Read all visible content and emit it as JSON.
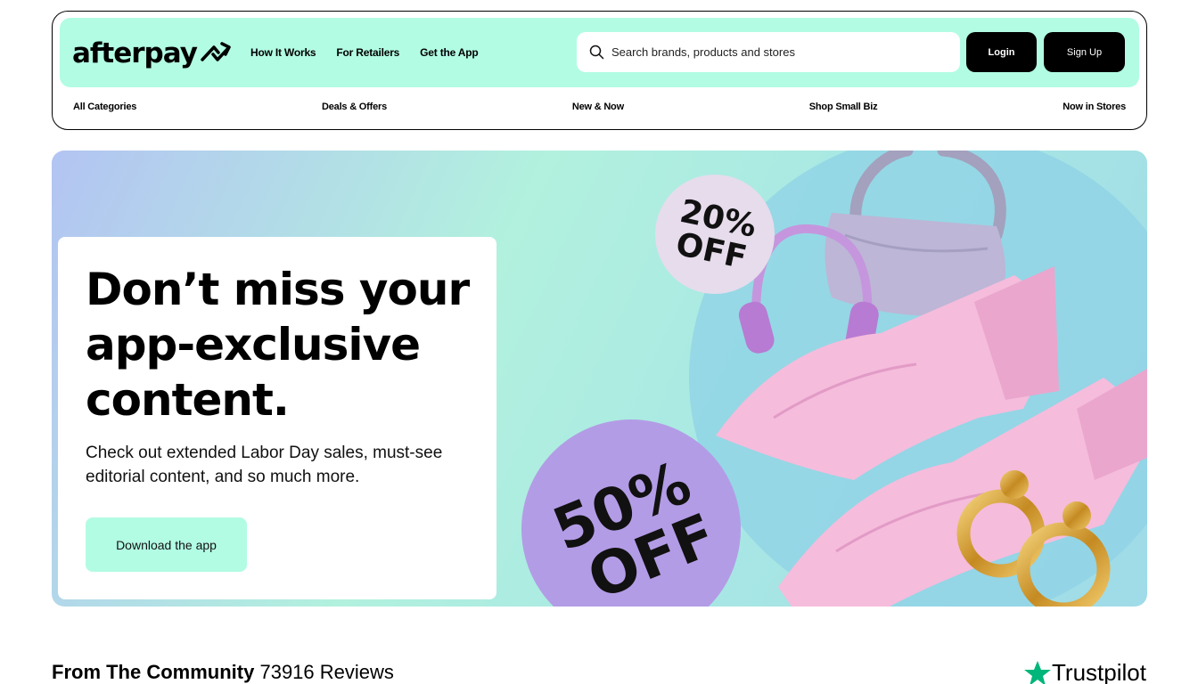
{
  "header": {
    "logo_text": "afterpay",
    "nav": [
      "How It Works",
      "For Retailers",
      "Get the App"
    ],
    "search_placeholder": "Search brands, products and stores",
    "login_label": "Login",
    "signup_label": "Sign Up",
    "categories": [
      "All Categories",
      "Deals & Offers",
      "New & Now",
      "Shop Small Biz",
      "Now in Stores"
    ]
  },
  "hero": {
    "title": "Don’t miss your app-exclusive content.",
    "subtitle": "Check out extended Labor Day sales, must-see editorial content, and so much more.",
    "cta_label": "Download the app",
    "badge_small": [
      "20%",
      "OFF"
    ],
    "badge_large": [
      "50%",
      "OFF"
    ]
  },
  "community": {
    "heading": "From The Community",
    "reviews": "73916 Reviews",
    "brand": "Trustpilot"
  },
  "colors": {
    "mint": "#b2fce4",
    "black": "#000000",
    "trustpilot_green": "#00b67a",
    "lavender": "#b39ce6"
  },
  "icons": [
    "afterpay-logo-icon",
    "search-icon",
    "trustpilot-star-icon"
  ]
}
